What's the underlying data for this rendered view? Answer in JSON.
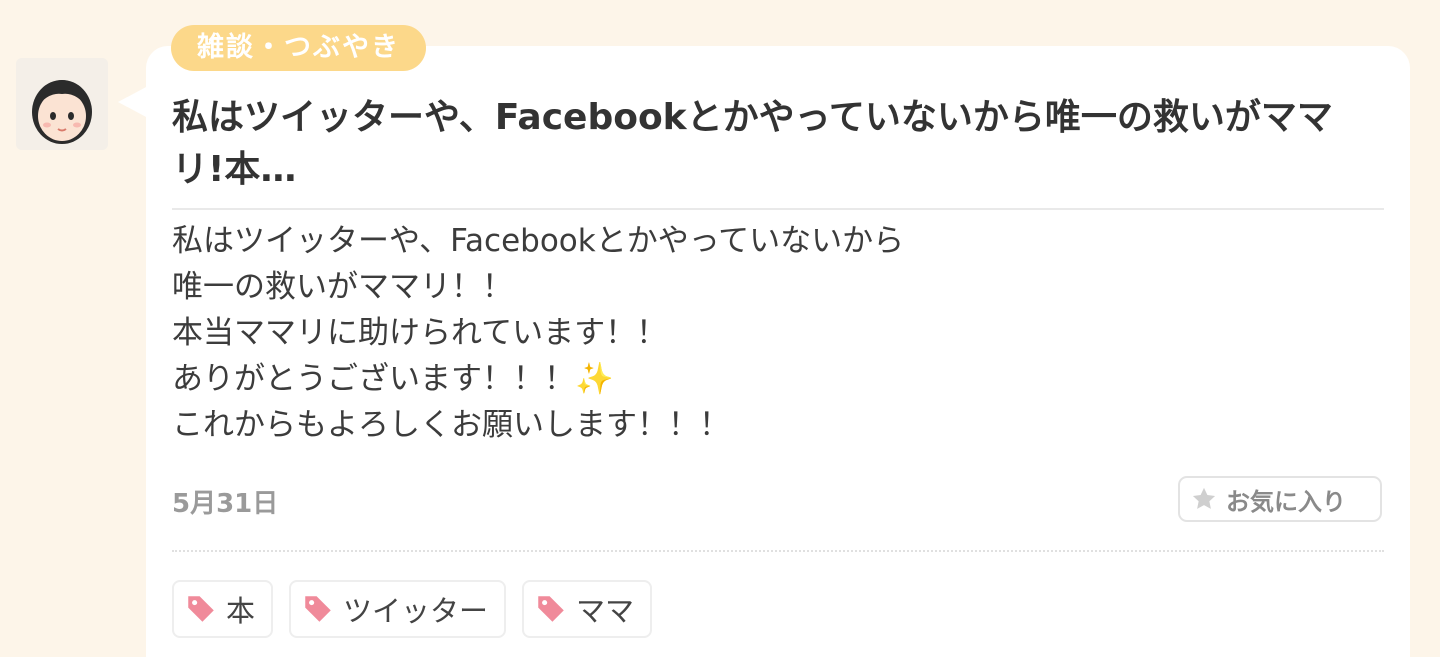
{
  "post": {
    "category": "雑談・つぶやき",
    "title": "私はツイッターや、Facebookとかやっていないから唯一の救いがママリ!本…",
    "body_lines": [
      "私はツイッターや、Facebookとかやっていないから",
      "唯一の救いがママリ！！",
      "本当ママリに助けられています！！",
      "ありがとうございます！！！✨",
      "これからもよろしくお願いします！！！"
    ],
    "date": "5月31日",
    "favorite_label": "お気に入り",
    "tags": [
      "本",
      "ツイッター",
      "ママ"
    ]
  },
  "icons": {
    "avatar": "user-avatar-icon",
    "favorite": "star-icon",
    "tag": "tag-icon"
  },
  "colors": {
    "background": "#fdf5e9",
    "category_badge": "#fcd88a",
    "tag_icon": "#f08a9a",
    "star_icon": "#cfcfcf"
  }
}
